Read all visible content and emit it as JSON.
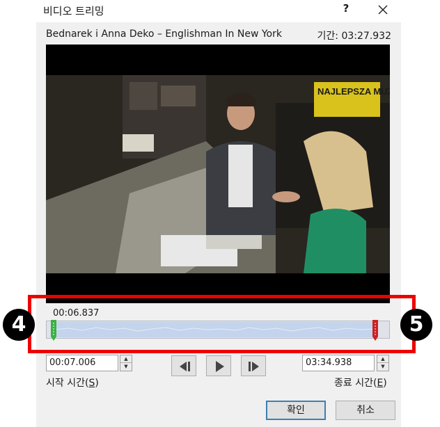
{
  "window": {
    "title": "비디오 트리밍",
    "help_label": "?"
  },
  "video": {
    "name": "Bednarek i Anna Deko – Englishman In New York",
    "duration": "기간: 03:27.932",
    "overlay_text": "NAJLEPSZA MUZYKA"
  },
  "timeline": {
    "current_time": "00:06.837",
    "start_position": 0.034,
    "end_position": 0.955
  },
  "start_time": {
    "value": "00:07.006",
    "label": "시작 시간(",
    "accel": "S",
    "label_end": ")"
  },
  "end_time": {
    "value": "03:34.938",
    "label": "종료 시간(",
    "accel": "E",
    "label_end": ")"
  },
  "buttons": {
    "ok": "확인",
    "cancel": "취소"
  },
  "callouts": {
    "start": "4",
    "end": "5"
  },
  "colors": {
    "highlight": "#ee0000",
    "start_marker": "#3cb043",
    "end_marker": "#cc2222",
    "ok_border": "#3c7fb1"
  }
}
